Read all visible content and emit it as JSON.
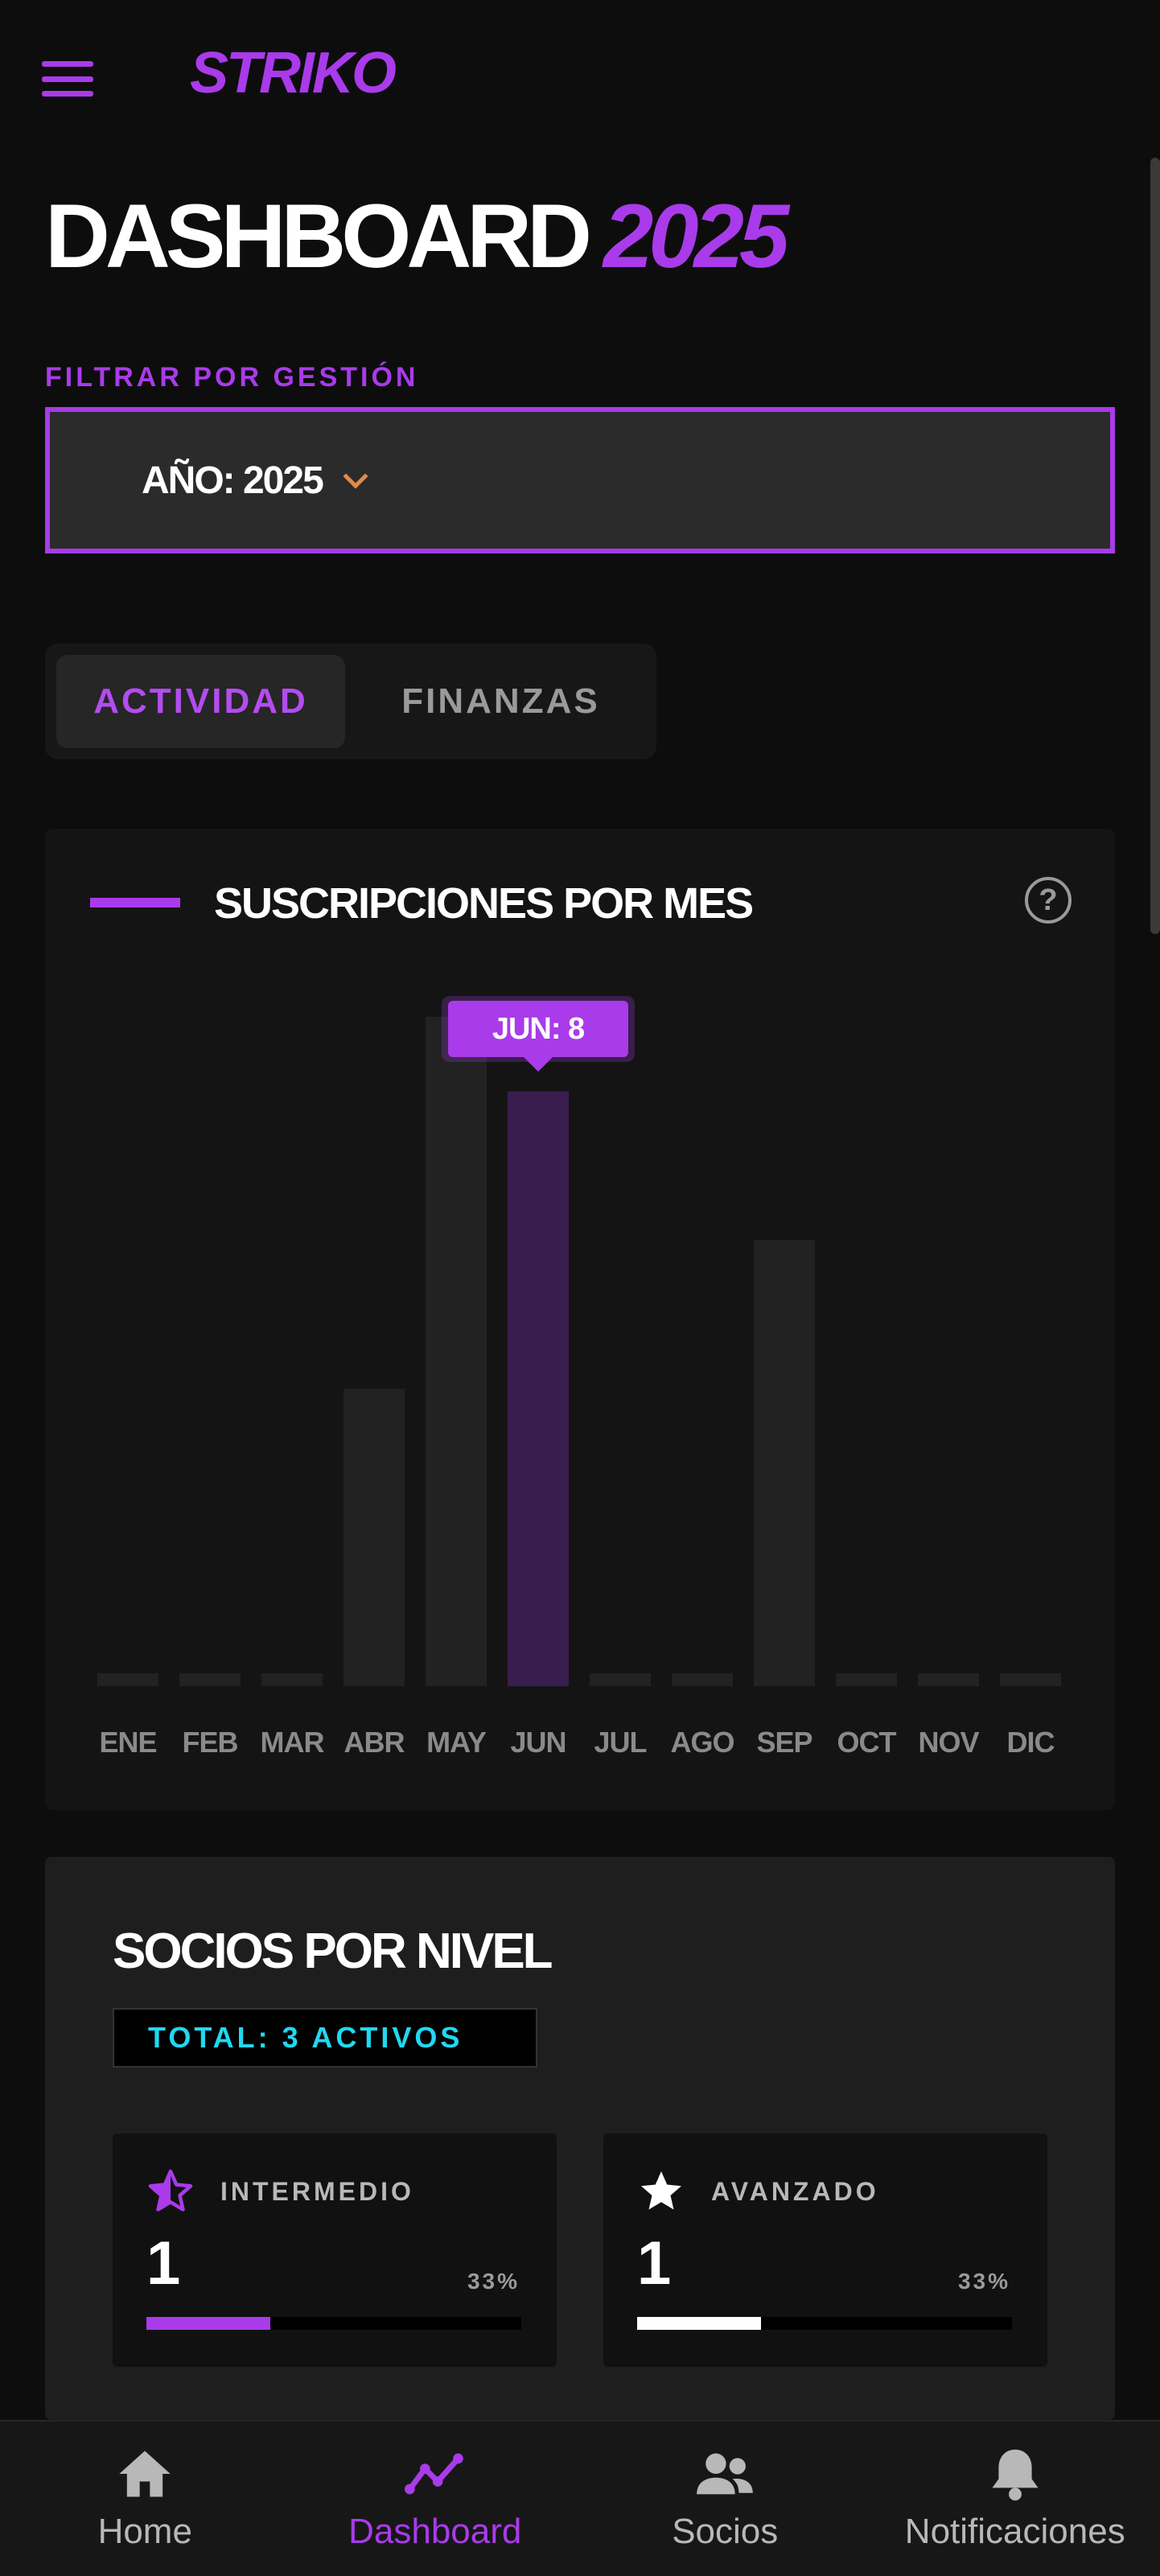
{
  "header": {
    "brand": "STRIKO"
  },
  "page": {
    "title": "DASHBOARD",
    "year": "2025"
  },
  "filter": {
    "label": "FILTRAR POR GESTIÓN",
    "selected": "AÑO: 2025"
  },
  "tabs": [
    {
      "label": "ACTIVIDAD",
      "active": true
    },
    {
      "label": "FINANZAS",
      "active": false
    }
  ],
  "chart_card": {
    "title": "SUSCRIPCIONES POR MES",
    "help": "?"
  },
  "chart_data": {
    "type": "bar",
    "title": "SUSCRIPCIONES POR MES",
    "categories": [
      "ENE",
      "FEB",
      "MAR",
      "ABR",
      "MAY",
      "JUN",
      "JUL",
      "AGO",
      "SEP",
      "OCT",
      "NOV",
      "DIC"
    ],
    "values": [
      0,
      0,
      0,
      4,
      9,
      8,
      0,
      0,
      6,
      0,
      0,
      0
    ],
    "ylim": [
      0,
      9
    ],
    "highlight": {
      "category": "JUN",
      "tooltip": "JUN: 8"
    },
    "bar_color": "#222222",
    "highlight_color": "#3a1d4f",
    "accent": "#a93bea",
    "grid": false
  },
  "socios": {
    "title": "SOCIOS POR NIVEL",
    "total": "TOTAL: 3 ACTIVOS",
    "levels": [
      {
        "name": "INTERMEDIO",
        "count": "1",
        "pct": "33%",
        "fraction": 0.33,
        "color": "#a93bea",
        "icon": "half-star-icon"
      },
      {
        "name": "AVANZADO",
        "count": "1",
        "pct": "33%",
        "fraction": 0.33,
        "color": "#ffffff",
        "icon": "star-icon"
      }
    ]
  },
  "nav": [
    {
      "label": "Home",
      "icon": "home-icon",
      "active": false
    },
    {
      "label": "Dashboard",
      "icon": "chart-line-icon",
      "active": true
    },
    {
      "label": "Socios",
      "icon": "users-icon",
      "active": false
    },
    {
      "label": "Notificaciones",
      "icon": "bell-icon",
      "active": false
    }
  ],
  "colors": {
    "accent": "#a93bea",
    "background": "#0d0d0d",
    "cyan": "#21d8f0",
    "chevron": "#e08a4a"
  }
}
